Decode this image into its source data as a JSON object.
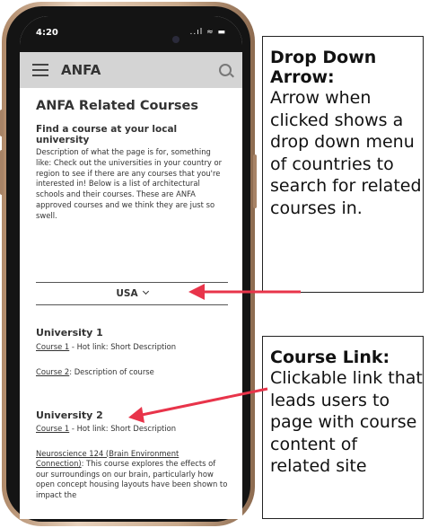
{
  "status": {
    "time": "4:20",
    "icons": "..ıl ≈ ▬"
  },
  "app": {
    "title": "ANFA"
  },
  "page": {
    "title": "ANFA Related Courses",
    "subtitle": "Find a course at your local university",
    "description": "Description of what the page is for, something like: Check out the universities in your country or region to see if there are any courses that you're interested in! Below is a list of architectural schools and their courses. These are ANFA approved courses and we think they are just so swell."
  },
  "dropdown": {
    "value": "USA"
  },
  "universities": [
    {
      "name": "University 1",
      "courses": [
        {
          "link": "Course 1",
          "text": " - Hot link: Short Description"
        },
        {
          "link": "Course 2",
          "text": ": Description of course"
        }
      ]
    },
    {
      "name": "University 2",
      "courses": [
        {
          "link": "Course 1",
          "text": " - Hot link: Short Description"
        },
        {
          "link": "Neuroscience 124 (Brain Environment Connection)",
          "text": ": This course explores the effects of our surroundings on our brain, particularly how open concept housing layouts have been shown to impact the"
        }
      ]
    }
  ],
  "annotations": [
    {
      "title": "Drop Down Arrow:",
      "body": "Arrow when clicked shows a drop down menu of countries to search for related courses in."
    },
    {
      "title": "Course Link:",
      "body": "Clickable link that leads users to page with course content of related site"
    }
  ],
  "colors": {
    "arrow": "#e8344a",
    "appbar": "#d4d4d4",
    "frame": "#c9a98b"
  }
}
